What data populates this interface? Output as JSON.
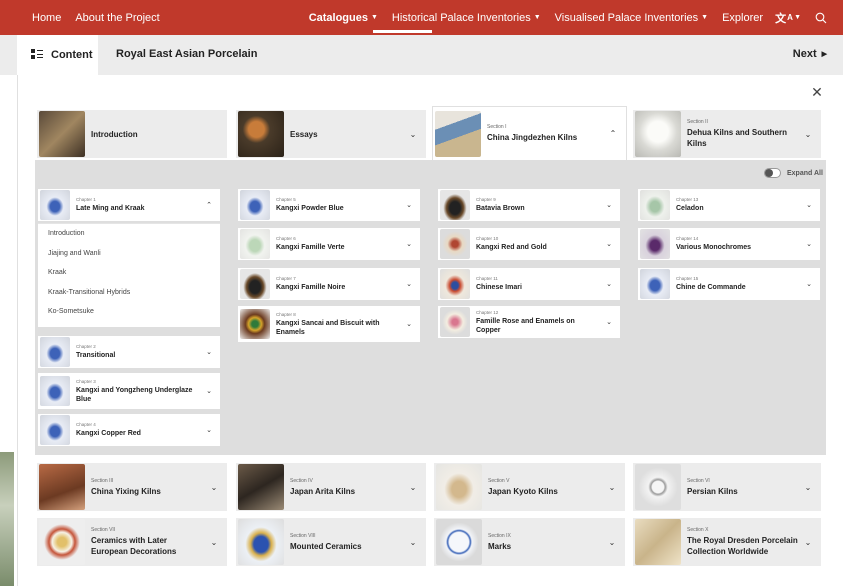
{
  "nav": {
    "left": [
      "Home",
      "About the Project"
    ],
    "right": [
      {
        "label": "Catalogues",
        "active": true,
        "dropdown": true
      },
      {
        "label": "Historical Palace Inventories",
        "active": false,
        "dropdown": true
      },
      {
        "label": "Visualised Palace Inventories",
        "active": false,
        "dropdown": true
      },
      {
        "label": "Explorer",
        "active": false,
        "dropdown": false
      }
    ],
    "language_icon": "translate-icon",
    "search_icon": "search-icon",
    "accent_color": "#c0392b"
  },
  "subbar": {
    "content_label": "Content",
    "title": "Royal East Asian Porcelain",
    "next_label": "Next"
  },
  "sections_top": [
    {
      "kicker": "",
      "title": "Introduction",
      "chevron": "",
      "thumb": "t-brown"
    },
    {
      "kicker": "",
      "title": "Essays",
      "chevron": "⌄",
      "thumb": "t-still"
    },
    {
      "kicker": "Section I",
      "title": "China Jingdezhen Kilns",
      "chevron": "⌃",
      "thumb": "t-kiln"
    },
    {
      "kicker": "Section II",
      "title": "Dehua Kilns and Southern Kilns",
      "chevron": "⌄",
      "thumb": "t-white"
    }
  ],
  "expand_all_label": "Expand All",
  "chapters": {
    "col1": [
      {
        "kicker": "Chapter 1",
        "title": "Late Ming and Kraak",
        "chevron": "⌃",
        "thumb": "t-blue"
      },
      {
        "kicker": "Chapter 2",
        "title": "Transitional",
        "chevron": "⌄",
        "thumb": "t-blue"
      },
      {
        "kicker": "Chapter 3",
        "title": "Kangxi and Yongzheng Underglaze Blue",
        "chevron": "⌄",
        "thumb": "t-blue"
      },
      {
        "kicker": "Chapter 4",
        "title": "Kangxi Copper Red",
        "chevron": "⌄",
        "thumb": "t-blue"
      }
    ],
    "col1_subitems": [
      "Introduction",
      "Jiajing and Wanli",
      "Kraak",
      "Kraak-Transitional Hybrids",
      "Ko-Sometsuke"
    ],
    "col2": [
      {
        "kicker": "Chapter 5",
        "title": "Kangxi Powder Blue",
        "chevron": "⌄",
        "thumb": "t-blue"
      },
      {
        "kicker": "Chapter 6",
        "title": "Kangxi Famille Verte",
        "chevron": "⌄",
        "thumb": "t-vase-g"
      },
      {
        "kicker": "Chapter 7",
        "title": "Kangxi Famille Noire",
        "chevron": "⌄",
        "thumb": "t-bowl"
      },
      {
        "kicker": "Chapter 8",
        "title": "Kangxi Sancai and Biscuit with Enamels",
        "chevron": "⌄",
        "thumb": "t-sancai"
      }
    ],
    "col3": [
      {
        "kicker": "Chapter 9",
        "title": "Batavia Brown",
        "chevron": "⌄",
        "thumb": "t-bowl"
      },
      {
        "kicker": "Chapter 10",
        "title": "Kangxi Red and Gold",
        "chevron": "⌄",
        "thumb": "t-red"
      },
      {
        "kicker": "Chapter 11",
        "title": "Chinese Imari",
        "chevron": "⌄",
        "thumb": "t-imari"
      },
      {
        "kicker": "Chapter 12",
        "title": "Famille Rose and Enamels on Copper",
        "chevron": "⌄",
        "thumb": "t-rose"
      }
    ],
    "col4": [
      {
        "kicker": "Chapter 13",
        "title": "Celadon",
        "chevron": "⌄",
        "thumb": "t-celadon"
      },
      {
        "kicker": "Chapter 14",
        "title": "Various Monochromes",
        "chevron": "⌄",
        "thumb": "t-mono"
      },
      {
        "kicker": "Chapter 15",
        "title": "Chine de Commande",
        "chevron": "⌄",
        "thumb": "t-blue"
      }
    ]
  },
  "sections_bottom": [
    {
      "kicker": "Section III",
      "title": "China Yixing Kilns",
      "chevron": "⌄",
      "thumb": "t-yixing"
    },
    {
      "kicker": "Section IV",
      "title": "Japan Arita Kilns",
      "chevron": "⌄",
      "thumb": "t-arita"
    },
    {
      "kicker": "Section V",
      "title": "Japan Kyoto Kilns",
      "chevron": "⌄",
      "thumb": "t-kyoto"
    },
    {
      "kicker": "Section VI",
      "title": "Persian Kilns",
      "chevron": "⌄",
      "thumb": "t-persian"
    },
    {
      "kicker": "Section VII",
      "title": "Ceramics with Later European Decorations",
      "chevron": "⌄",
      "thumb": "t-euro"
    },
    {
      "kicker": "Section VIII",
      "title": "Mounted Ceramics",
      "chevron": "⌄",
      "thumb": "t-mounted"
    },
    {
      "kicker": "Section IX",
      "title": "Marks",
      "chevron": "⌄",
      "thumb": "t-marks"
    },
    {
      "kicker": "Section X",
      "title": "The Royal Dresden Porcelain Collection Worldwide",
      "chevron": "⌄",
      "thumb": "t-map"
    }
  ]
}
